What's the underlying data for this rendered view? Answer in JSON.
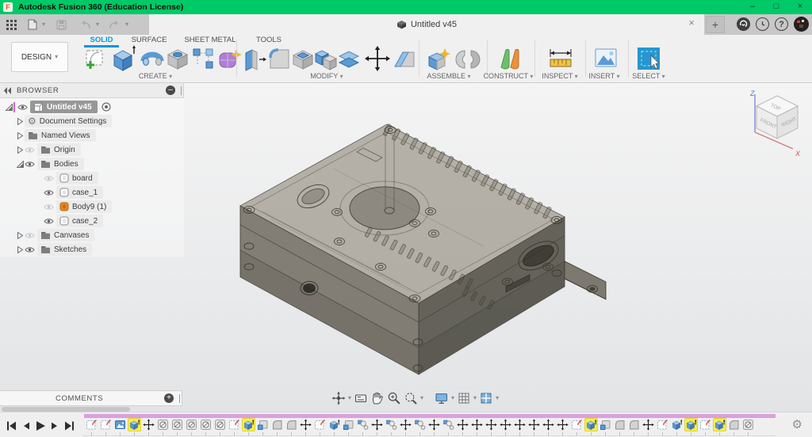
{
  "window": {
    "title": "Autodesk Fusion 360 (Education License)",
    "minimize": "–",
    "maximize": "□",
    "close": "×"
  },
  "tabbar": {
    "document_tab": {
      "title": "Untitled v45",
      "close": "×"
    },
    "new_tab": "+",
    "help": "?"
  },
  "toolbar": {
    "design_menu": "DESIGN",
    "tabs": [
      {
        "label": "SOLID",
        "active": true
      },
      {
        "label": "SURFACE",
        "active": false
      },
      {
        "label": "SHEET METAL",
        "active": false
      },
      {
        "label": "TOOLS",
        "active": false
      }
    ],
    "groups": [
      {
        "label": "CREATE",
        "tools": [
          "create-sketch",
          "extrude",
          "revolve",
          "hole",
          "rectangular-pattern",
          "create-form"
        ]
      },
      {
        "label": "MODIFY",
        "tools": [
          "press-pull",
          "fillet",
          "shell",
          "combine",
          "offset-face",
          "move",
          "chamfer"
        ]
      },
      {
        "label": "ASSEMBLE",
        "tools": [
          "new-component",
          "joint"
        ]
      },
      {
        "label": "CONSTRUCT",
        "tools": [
          "construction-plane"
        ]
      },
      {
        "label": "INSPECT",
        "tools": [
          "measure"
        ]
      },
      {
        "label": "INSERT",
        "tools": [
          "insert-image"
        ]
      },
      {
        "label": "SELECT",
        "tools": [
          "select"
        ]
      }
    ]
  },
  "browser": {
    "title": "BROWSER",
    "tree": [
      {
        "label": "Untitled v45",
        "depth": 0,
        "icon": "document-cube",
        "eye": "visible",
        "expander": "expanded",
        "selected": true,
        "radio": true
      },
      {
        "label": "Document Settings",
        "depth": 1,
        "icon": "gear",
        "expander": "collapsed"
      },
      {
        "label": "Named Views",
        "depth": 1,
        "icon": "folder",
        "expander": "collapsed"
      },
      {
        "label": "Origin",
        "depth": 1,
        "icon": "folder",
        "eye": "hidden",
        "expander": "collapsed"
      },
      {
        "label": "Bodies",
        "depth": 1,
        "icon": "folder",
        "eye": "visible",
        "expander": "expanded"
      },
      {
        "label": "board",
        "depth": 2,
        "icon": "body",
        "eye": "hidden"
      },
      {
        "label": "case_1",
        "depth": 2,
        "icon": "body",
        "eye": "visible"
      },
      {
        "label": "Body9 (1)",
        "depth": 2,
        "icon": "body-orange",
        "eye": "hidden"
      },
      {
        "label": "case_2",
        "depth": 2,
        "icon": "body",
        "eye": "visible"
      },
      {
        "label": "Canvases",
        "depth": 1,
        "icon": "folder",
        "eye": "hidden",
        "expander": "collapsed"
      },
      {
        "label": "Sketches",
        "depth": 1,
        "icon": "folder",
        "eye": "visible",
        "expander": "collapsed"
      }
    ]
  },
  "comments": {
    "title": "COMMENTS"
  },
  "viewcube": {
    "top": "TOP",
    "front": "FRONT",
    "right": "RIGHT",
    "axis_x": "X",
    "axis_z": "Z"
  },
  "navbar_tools": [
    "orbit",
    "look-at",
    "pan",
    "zoom",
    "fit-window-zoom",
    "display-settings",
    "layout-grid",
    "viewports"
  ],
  "timeline": {
    "playback": [
      "skip-to-start",
      "step-back",
      "play",
      "step-forward",
      "skip-to-end"
    ],
    "ops": [
      {
        "type": "sketch"
      },
      {
        "type": "sketch"
      },
      {
        "type": "canvas"
      },
      {
        "type": "extrude",
        "highlight": true
      },
      {
        "type": "move"
      },
      {
        "type": "hole"
      },
      {
        "type": "hole"
      },
      {
        "type": "hole"
      },
      {
        "type": "hole"
      },
      {
        "type": "hole"
      },
      {
        "type": "sketch"
      },
      {
        "type": "extrude",
        "highlight": true
      },
      {
        "type": "press-pull"
      },
      {
        "type": "fillet"
      },
      {
        "type": "fillet"
      },
      {
        "type": "move"
      },
      {
        "type": "sketch"
      },
      {
        "type": "extrude"
      },
      {
        "type": "press-pull"
      },
      {
        "type": "component"
      },
      {
        "type": "move"
      },
      {
        "type": "component"
      },
      {
        "type": "move"
      },
      {
        "type": "component"
      },
      {
        "type": "move"
      },
      {
        "type": "component"
      },
      {
        "type": "move"
      },
      {
        "type": "move"
      },
      {
        "type": "move"
      },
      {
        "type": "move"
      },
      {
        "type": "move"
      },
      {
        "type": "move"
      },
      {
        "type": "move"
      },
      {
        "type": "move"
      },
      {
        "type": "sketch"
      },
      {
        "type": "extrude",
        "highlight": true
      },
      {
        "type": "press-pull"
      },
      {
        "type": "fillet"
      },
      {
        "type": "fillet"
      },
      {
        "type": "move"
      },
      {
        "type": "sketch"
      },
      {
        "type": "extrude"
      },
      {
        "type": "extrude",
        "highlight": true
      },
      {
        "type": "sketch"
      },
      {
        "type": "extrude",
        "highlight": true
      },
      {
        "type": "fillet"
      },
      {
        "type": "hole"
      }
    ]
  },
  "icon_glyphs": {
    "gear": "⚙",
    "caret_down": "▾",
    "collapse_panel": "–",
    "add_comment": "+"
  },
  "colors": {
    "titlebar_green": "#00c967",
    "accent_blue": "#0a96d8",
    "highlight_yellow": "#f6ec4d",
    "timeline_marker_pink": "#db9fdf",
    "selected_row_gray": "#979797",
    "selected_bar_magenta": "#d45fd4",
    "body_icon_orange": "#e8881f"
  }
}
